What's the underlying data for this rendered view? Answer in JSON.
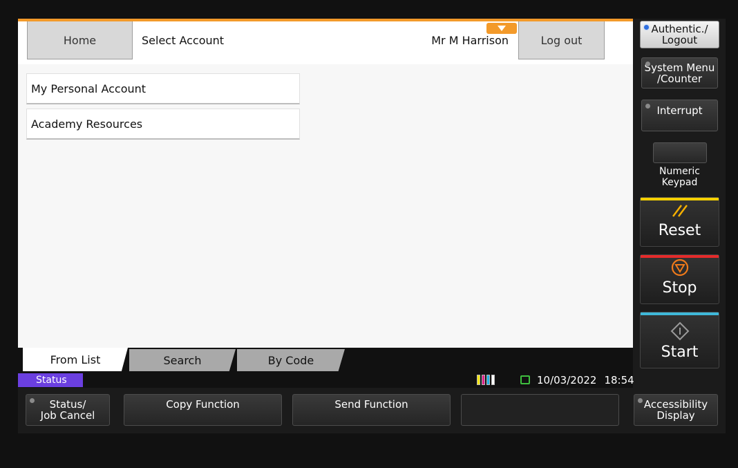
{
  "header": {
    "home_label": "Home",
    "title": "Select Account",
    "user": "Mr M Harrison",
    "logout_label": "Log out"
  },
  "accounts": [
    {
      "label": "My Personal Account"
    },
    {
      "label": "Academy Resources"
    }
  ],
  "tabs": [
    {
      "label": "From List",
      "active": true
    },
    {
      "label": "Search",
      "active": false
    },
    {
      "label": "By Code",
      "active": false
    }
  ],
  "status_bar": {
    "status_label": "Status",
    "date": "10/03/2022",
    "time": "18:54"
  },
  "side_keys": {
    "auth_logout": "Authentic./\nLogout",
    "system_menu": "System Menu\n/Counter",
    "interrupt": "Interrupt",
    "numeric_keypad": "Numeric\nKeypad",
    "reset": "Reset",
    "stop": "Stop",
    "start": "Start"
  },
  "bottom_keys": {
    "status_job_cancel": "Status/\nJob Cancel",
    "copy_function": "Copy Function",
    "send_function": "Send Function",
    "accessibility_display": "Accessibility\nDisplay"
  },
  "colors": {
    "accent_orange": "#f39a2a",
    "status_purple": "#6b3fe0",
    "reset_bar": "#f5d000",
    "stop_bar": "#e52b2b",
    "start_bar": "#3fb8d9"
  }
}
